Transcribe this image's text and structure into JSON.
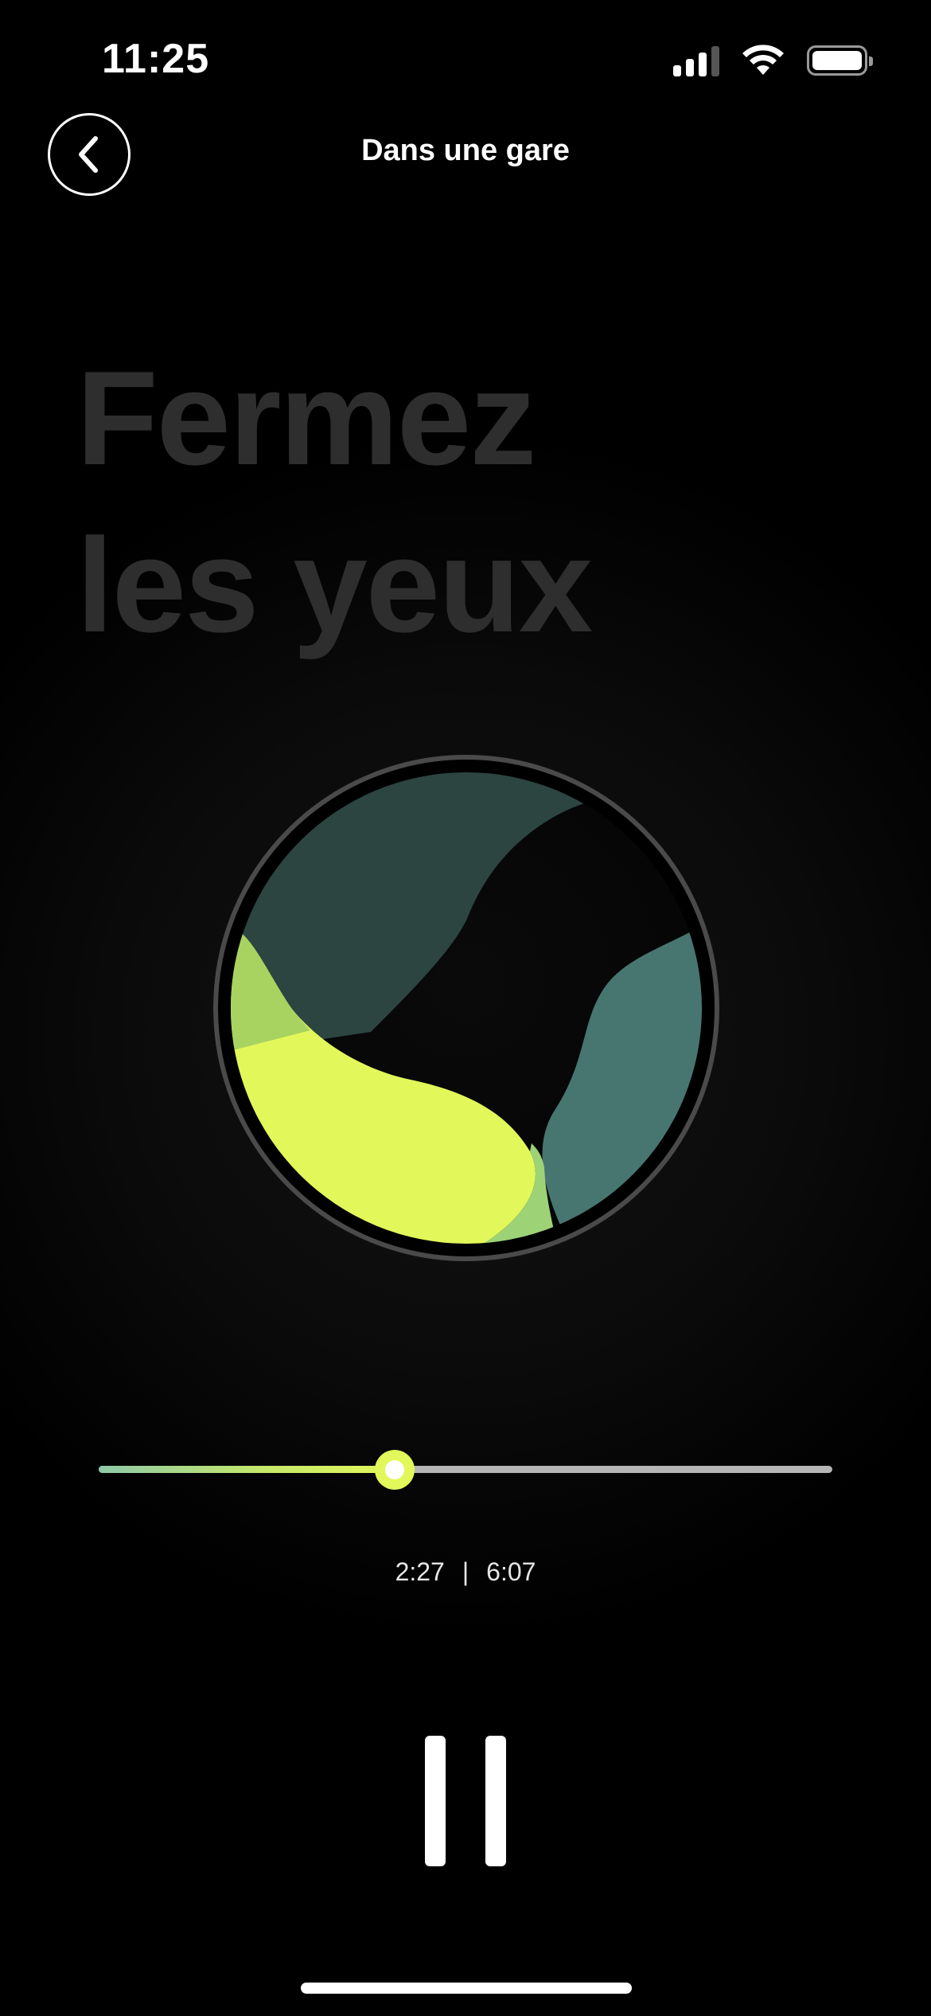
{
  "status_bar": {
    "time": "11:25",
    "icons": [
      "signal-icon",
      "wifi-icon",
      "battery-icon"
    ]
  },
  "header": {
    "title": "Dans une gare",
    "back_icon": "chevron-left-icon"
  },
  "instruction": {
    "line1": "Fermez",
    "line2": "les yeux"
  },
  "player": {
    "elapsed": "2:27",
    "separator": "|",
    "total": "6:07",
    "progress_fraction": 0.404,
    "pause_icon": "pause-icon"
  },
  "colors": {
    "accent_lime": "#e2f85a",
    "teal_dark": "#2c4541",
    "teal": "#477670",
    "lime_green": "#a4d46a",
    "background": "#000000",
    "instruction_text": "#2e2e2e"
  }
}
